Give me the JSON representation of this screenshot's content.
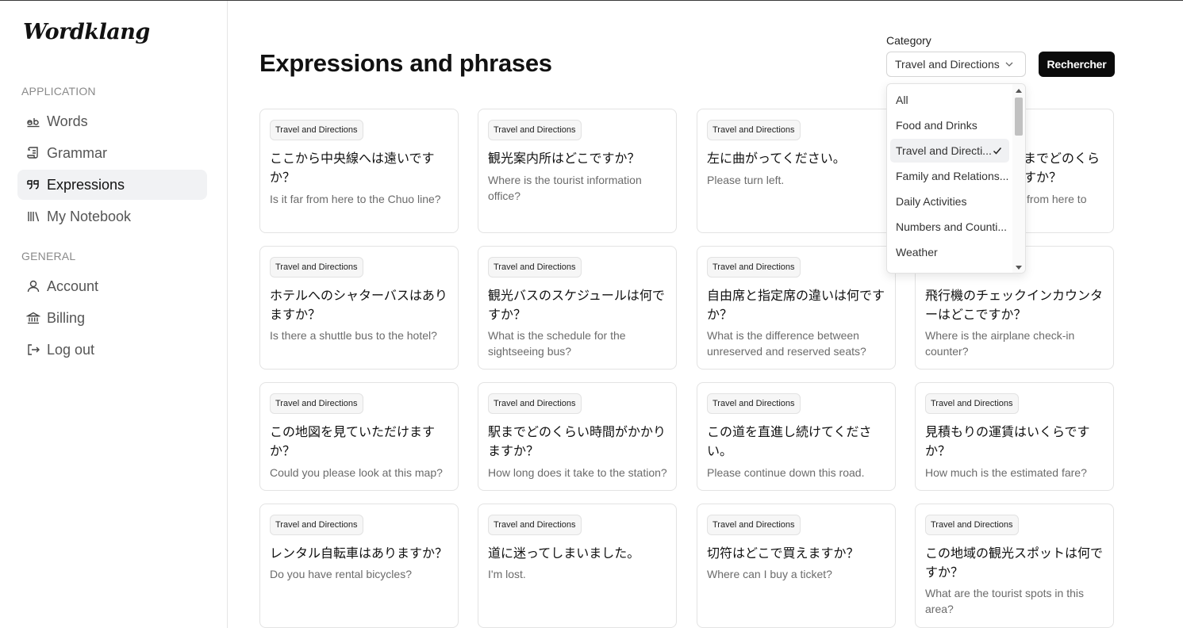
{
  "app": {
    "logo": "Wordklang"
  },
  "sidebar": {
    "sections": [
      {
        "label": "APPLICATION",
        "items": [
          {
            "label": "Words",
            "icon": "ab-icon",
            "active": false
          },
          {
            "label": "Grammar",
            "icon": "scroll-icon",
            "active": false
          },
          {
            "label": "Expressions",
            "icon": "quote-icon",
            "active": true
          },
          {
            "label": "My Notebook",
            "icon": "library-icon",
            "active": false
          }
        ]
      },
      {
        "label": "GENERAL",
        "items": [
          {
            "label": "Account",
            "icon": "user-icon",
            "active": false
          },
          {
            "label": "Billing",
            "icon": "bank-icon",
            "active": false
          },
          {
            "label": "Log out",
            "icon": "logout-icon",
            "active": false
          }
        ]
      }
    ]
  },
  "main": {
    "title": "Expressions and phrases",
    "filter": {
      "label": "Category",
      "selected": "Travel and Directions",
      "button": "Rechercher",
      "options": [
        "All",
        "Food and Drinks",
        "Travel and Directi...",
        "Family and Relations...",
        "Daily Activities",
        "Numbers and Counti...",
        "Weather"
      ],
      "selected_index": 2
    },
    "cards": [
      {
        "badge": "Travel and Directions",
        "jp": "ここから中央線へは遠いですか？",
        "en": "Is it far from here to the Chuo line?"
      },
      {
        "badge": "Travel and Directions",
        "jp": "観光案内所はどこですか？",
        "en": "Where is the tourist information office?"
      },
      {
        "badge": "Travel and Directions",
        "jp": "左に曲がってください。",
        "en": "Please turn left."
      },
      {
        "badge": "",
        "jp": "までどのくらすか？",
        "en": "from here to"
      },
      {
        "badge": "Travel and Directions",
        "jp": "ホテルへのシャターバスはありますか？",
        "en": "Is there a shuttle bus to the hotel?"
      },
      {
        "badge": "Travel and Directions",
        "jp": "観光バスのスケジュールは何ですか？",
        "en": "What is the schedule for the sightseeing bus?"
      },
      {
        "badge": "Travel and Directions",
        "jp": "自由席と指定席の違いは何ですか？",
        "en": "What is the difference between unreserved and reserved seats?"
      },
      {
        "badge": "",
        "jp": "飛行機のチェックインカウンターはどこですか？",
        "en": "Where is the airplane check-in counter?"
      },
      {
        "badge": "Travel and Directions",
        "jp": "この地図を見ていただけますか？",
        "en": "Could you please look at this map?"
      },
      {
        "badge": "Travel and Directions",
        "jp": "駅までどのくらい時間がかかりますか？",
        "en": "How long does it take to the station?"
      },
      {
        "badge": "Travel and Directions",
        "jp": "この道を直進し続けてください。",
        "en": "Please continue down this road."
      },
      {
        "badge": "Travel and Directions",
        "jp": "見積もりの運賃はいくらですか？",
        "en": "How much is the estimated fare?"
      },
      {
        "badge": "Travel and Directions",
        "jp": "レンタル自転車はありますか？",
        "en": "Do you have rental bicycles?"
      },
      {
        "badge": "Travel and Directions",
        "jp": "道に迷ってしまいました。",
        "en": "I'm lost."
      },
      {
        "badge": "Travel and Directions",
        "jp": "切符はどこで買えますか？",
        "en": "Where can I buy a ticket?"
      },
      {
        "badge": "Travel and Directions",
        "jp": "この地域の観光スポットは何ですか？",
        "en": "What are the tourist spots in this area?"
      }
    ]
  }
}
